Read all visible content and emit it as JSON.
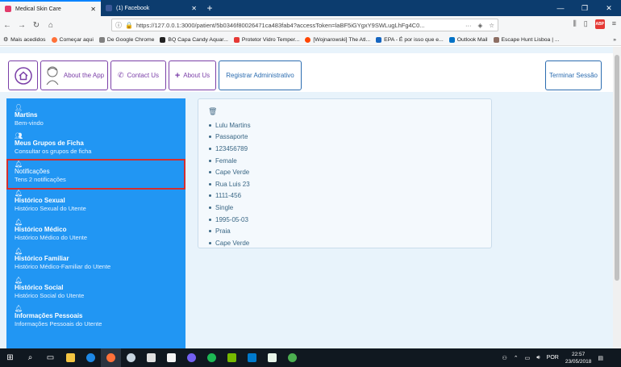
{
  "browser": {
    "tabs": [
      {
        "title": "Medical Skin Care",
        "favicon_color": "#e23b6b"
      },
      {
        "title": "(1) Facebook",
        "favicon_color": "#3b5998"
      }
    ],
    "url": "https://127.0.0.1:3000/patient/5b0346f80026471ca483fab4?accessToken=laBF5iGYgxY9SWLugLhFg4C0..."
  },
  "bookmarks": [
    {
      "label": "Mais acedidos",
      "icon": "gear-icon",
      "color": "#555555"
    },
    {
      "label": "Começar aqui",
      "icon": "firefox-icon",
      "color": "#ff7139"
    },
    {
      "label": "De Google Chrome",
      "icon": "folder-icon",
      "color": "#808080"
    },
    {
      "label": "BQ Capa Candy Aquar...",
      "icon": "bq-icon",
      "color": "#222222"
    },
    {
      "label": "Protetor Vidro Temper...",
      "icon": "shield-icon",
      "color": "#e53935"
    },
    {
      "label": "[Wojnarowski] The Atl...",
      "icon": "reddit-icon",
      "color": "#ff4500"
    },
    {
      "label": "EPA - É por isso que e...",
      "icon": "page-icon",
      "color": "#1565c0"
    },
    {
      "label": "Outlook Mail",
      "icon": "outlook-icon",
      "color": "#0072c6"
    },
    {
      "label": "Escape Hunt Lisboa | ...",
      "icon": "escape-icon",
      "color": "#8d6e63"
    }
  ],
  "nav": {
    "about_app": "About the App",
    "contact_us": "Contact Us",
    "about_us": "About Us",
    "register_admin": "Registrar Administrativo",
    "logout": "Terminar Sessão"
  },
  "sidebar": {
    "items": [
      {
        "title": "Martins",
        "sub": "Bem-vindo",
        "icon": "user-icon"
      },
      {
        "title": "Meus Grupos de Ficha",
        "sub": "Consultar os grupos de ficha",
        "icon": "users-icon"
      },
      {
        "title": "Notificações",
        "sub": "Tens 2 notificações",
        "icon": "bell-icon"
      },
      {
        "title": "Histórico Sexual",
        "sub": "Histórico Sexual do Utente",
        "icon": "bell-icon"
      },
      {
        "title": "Histórico Médico",
        "sub": "Histórico Médico do Utente",
        "icon": "bell-icon"
      },
      {
        "title": "Histórico Familiar",
        "sub": "Histórico Médico-Familiar do Utente",
        "icon": "bell-icon"
      },
      {
        "title": "Histórico Social",
        "sub": "Histórico Social do Utente",
        "icon": "bell-icon"
      },
      {
        "title": "Informações Pessoais",
        "sub": "Informações Pessoais do Utente",
        "icon": "bell-icon"
      }
    ],
    "highlighted_index": 2
  },
  "patient": {
    "details": [
      "Lulu Martins",
      "Passaporte",
      "123456789",
      "Female",
      "Cape Verde",
      "Rua Luis 23",
      "1111-456",
      "Single",
      "1995-05-03",
      "Praia",
      "Cape Verde"
    ]
  },
  "taskbar": {
    "language": "POR",
    "time": "22:57",
    "date": "23/05/2018"
  },
  "colors": {
    "sidebar": "#2196f3",
    "accent_purple": "#7b3fa8",
    "accent_blue": "#2b6cb0",
    "highlight": "#d32f2f"
  }
}
